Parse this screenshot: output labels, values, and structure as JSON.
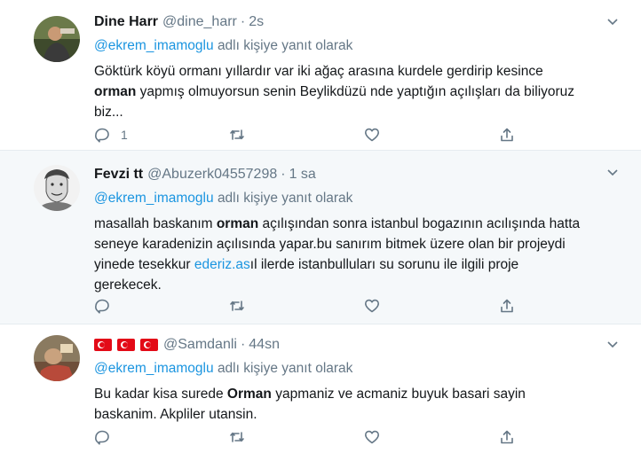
{
  "tweets": [
    {
      "name": "Dine Harr",
      "handle": "@dine_harr",
      "sep": "·",
      "time": "2s",
      "reply_user": "@ekrem_imamoglu",
      "reply_suffix": "adlı kişiye yanıt olarak",
      "t1": "Göktürk köyü ormanı yıllardır var iki ağaç arasına kurdele gerdirip kesince",
      "t2": "orman",
      "t3": " yapmış olmuyorsun senin Beylikdüzü nde yaptığın açılışları da biliyoruz biz...",
      "reply_count": "1"
    },
    {
      "name": "Fevzi tt",
      "handle": "@Abuzerk04557298",
      "sep": "·",
      "time": "1 sa",
      "reply_user": "@ekrem_imamoglu",
      "reply_suffix": "adlı kişiye yanıt olarak",
      "t1": "masallah baskanım ",
      "t2": "orman",
      "t3": " açılışından sonra istanbul bogazının acılışında hatta seneye karadenizin açılısında yapar.bu sanırım bitmek üzere olan bir projeydi yinede tesekkur ",
      "link": "ederiz.as",
      "t4": "ıl ilerde istanbulluları su sorunu ile ilgili proje gerekecek."
    },
    {
      "handle": "@Samdanli",
      "sep": "·",
      "time": "44sn",
      "reply_user": "@ekrem_imamoglu",
      "reply_suffix": "adlı kişiye yanıt olarak",
      "t1": "Bu kadar kisa surede ",
      "t2": "Orman",
      "t3": " yapmaniz ve acmaniz buyuk basari sayin baskanim. Akpliler utansin."
    }
  ],
  "icons": {
    "reply": "reply-icon",
    "retweet": "retweet-icon",
    "like": "like-icon",
    "share": "share-icon",
    "caret": "caret-down-icon"
  },
  "colors": {
    "link": "#1b95e0",
    "muted": "#657786",
    "highlight_bg": "#f5f8fa",
    "flag_red": "#e30a17"
  }
}
